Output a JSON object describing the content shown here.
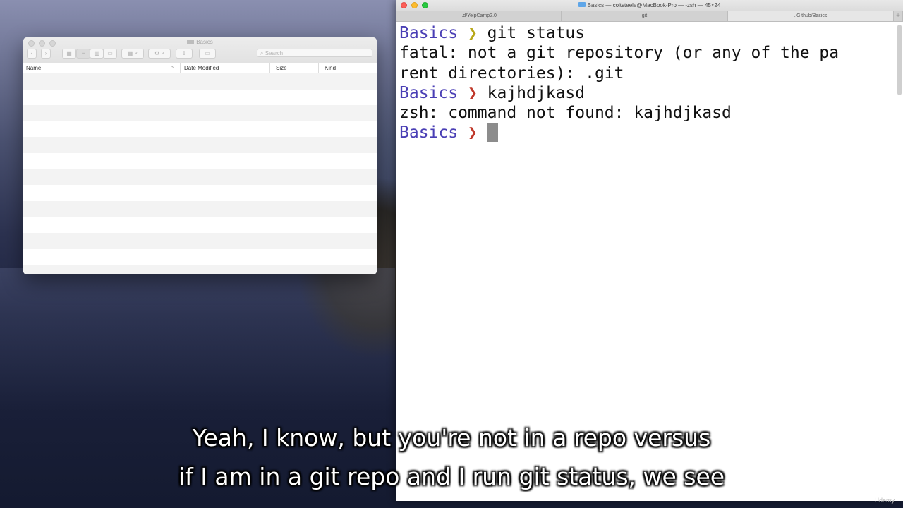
{
  "finder": {
    "title": "Basics",
    "search_placeholder": "Search",
    "columns": [
      "Name",
      "Date Modified",
      "Size",
      "Kind"
    ]
  },
  "terminal": {
    "title": "Basics — coltsteele@MacBook-Pro — -zsh — 45×24",
    "tabs": [
      "..d/YelpCamp2.0",
      "git",
      "..Github/Basics"
    ],
    "lines": [
      {
        "type": "prompt",
        "dir": "Basics",
        "arrow": "❯",
        "cmd": "git status",
        "status": "ok"
      },
      {
        "type": "output",
        "text": "fatal: not a git repository (or any of the pa"
      },
      {
        "type": "output",
        "text": "rent directories): .git"
      },
      {
        "type": "prompt",
        "dir": "Basics",
        "arrow": "❯",
        "cmd": "kajhdjkasd",
        "status": "err"
      },
      {
        "type": "output",
        "text": "zsh: command not found: kajhdjkasd"
      },
      {
        "type": "prompt",
        "dir": "Basics",
        "arrow": "❯",
        "cmd": "",
        "status": "err"
      }
    ]
  },
  "captions": {
    "line1": "Yeah, I know, but you're not in a repo versus",
    "line2": "if I am in a git repo and I run git status, we see"
  },
  "watermark": "Udemy",
  "colors": {
    "prompt_dir": "#4a3fb5",
    "arrow_ok": "#b8a81a",
    "arrow_err": "#c0392b"
  }
}
